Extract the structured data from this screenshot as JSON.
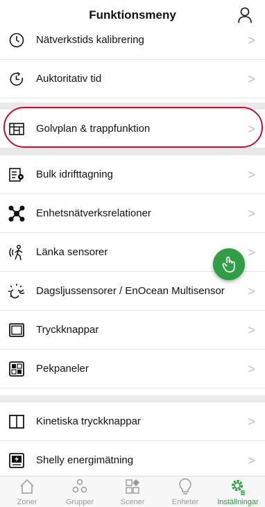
{
  "header": {
    "title": "Funktionsmeny",
    "user_icon": "user-icon"
  },
  "menu": {
    "chevron": ">",
    "items": [
      {
        "label": "Nätverkstids kalibrering",
        "icon": "clock-icon"
      },
      {
        "label": "Auktoritativ tid",
        "icon": "clock-sync-icon"
      },
      {
        "label": "Golvplan & trappfunktion",
        "icon": "floorplan-icon",
        "highlighted": true
      },
      {
        "label": "Bulk idrifttagning",
        "icon": "bulk-commission-icon"
      },
      {
        "label": "Enhetsnätverksrelationer",
        "icon": "network-icon"
      },
      {
        "label": "Länka sensorer",
        "icon": "link-sensor-icon"
      },
      {
        "label": "Dagsljussensorer / EnOcean Multisensor",
        "icon": "daylight-sensor-icon"
      },
      {
        "label": "Tryckknappar",
        "icon": "pushbutton-icon"
      },
      {
        "label": "Pekpaneler",
        "icon": "touchpanel-icon"
      },
      {
        "label": "Kinetiska tryckknappar",
        "icon": "kinetic-button-icon"
      },
      {
        "label": "Shelly energimätning",
        "icon": "energy-meter-icon"
      }
    ]
  },
  "fab": {
    "icon": "tap-hand-icon",
    "color": "#2f9e44"
  },
  "tabs": [
    {
      "label": "Zoner",
      "icon": "home-icon",
      "active": false
    },
    {
      "label": "Grupper",
      "icon": "groups-icon",
      "active": false
    },
    {
      "label": "Scener",
      "icon": "scenes-icon",
      "active": false
    },
    {
      "label": "Enheter",
      "icon": "bulb-icon",
      "active": false
    },
    {
      "label": "Inställningar",
      "icon": "settings-icon",
      "active": true
    }
  ],
  "colors": {
    "accent": "#1e9e3a",
    "highlight": "#c8102e",
    "separator": "#e9e9e9"
  }
}
